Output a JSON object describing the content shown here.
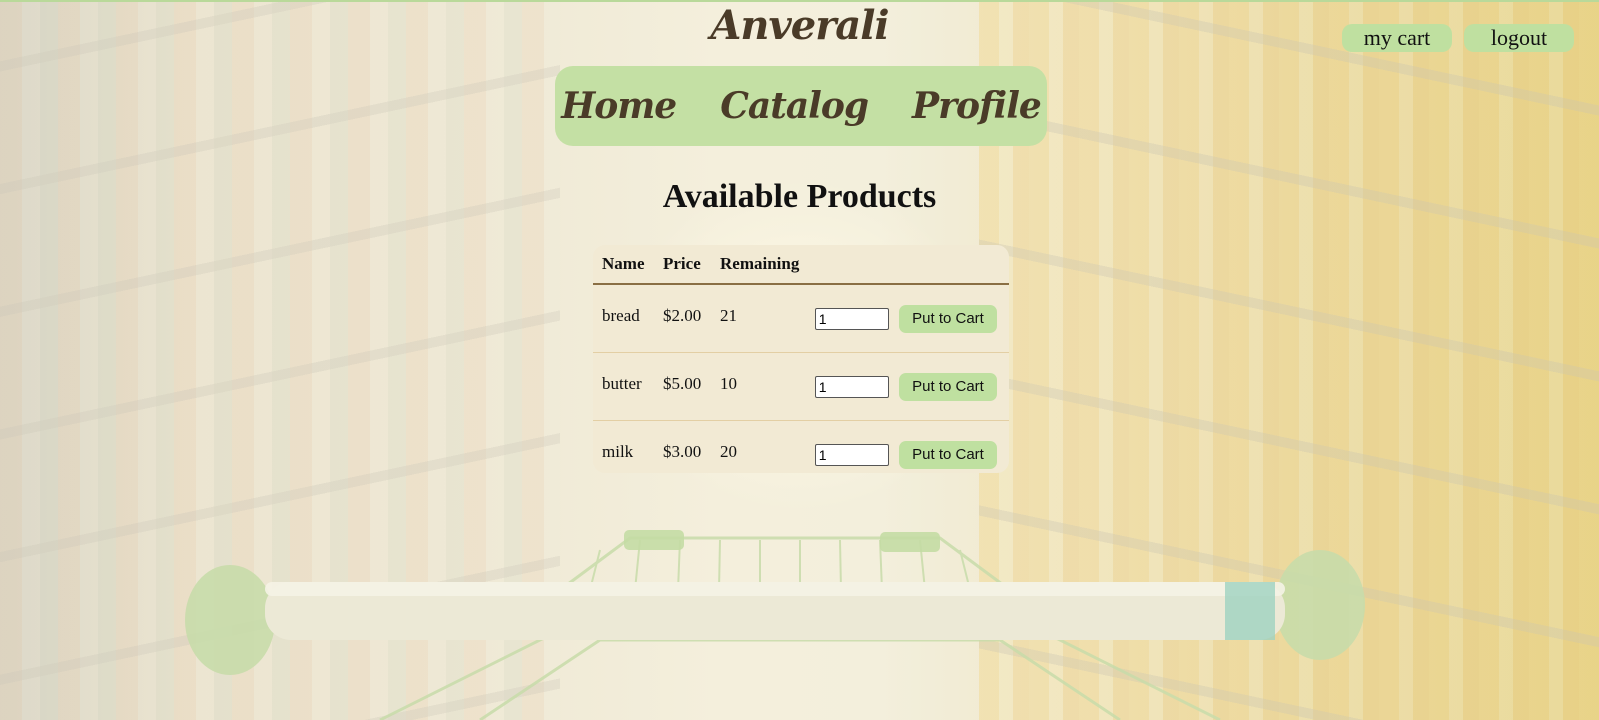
{
  "brand": "Anverali",
  "nav": [
    "Home",
    "Catalog",
    "Profile"
  ],
  "top_buttons": {
    "cart": "my cart",
    "logout": "logout"
  },
  "heading": "Available Products",
  "table": {
    "headers": [
      "Name",
      "Price",
      "Remaining"
    ],
    "rows": [
      {
        "name": "bread",
        "price": "$2.00",
        "remaining": "21",
        "qty": "1",
        "button": "Put to Cart"
      },
      {
        "name": "butter",
        "price": "$5.00",
        "remaining": "10",
        "qty": "1",
        "button": "Put to Cart"
      },
      {
        "name": "milk",
        "price": "$3.00",
        "remaining": "20",
        "qty": "1",
        "button": "Put to Cart"
      }
    ]
  },
  "colors": {
    "accent": "#c4e0a4",
    "table_bg": "#f2ead4",
    "brand_text": "#4a3b28"
  }
}
